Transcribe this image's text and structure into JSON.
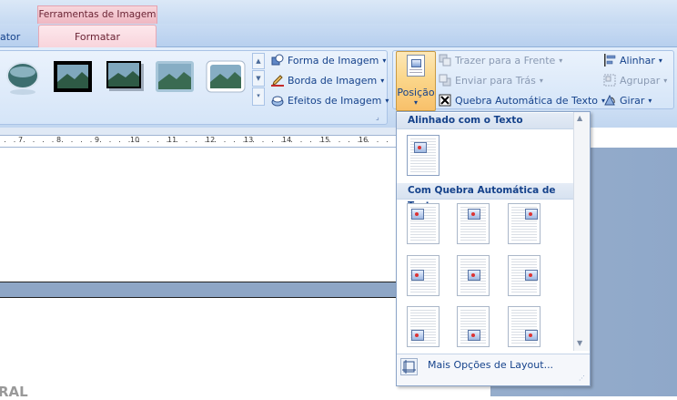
{
  "tabs": {
    "context_title": "Ferramentas de Imagem",
    "left_tab_partial": "ator",
    "active_tab": "Formatar"
  },
  "picture_styles": {
    "items": [
      "oval-reflected",
      "thick-black-frame",
      "drop-shadow-black",
      "soft-edge",
      "rounded-white-frame"
    ]
  },
  "picture_commands": {
    "shape": "Forma de Imagem",
    "border": "Borda de Imagem",
    "effects": "Efeitos de Imagem"
  },
  "arrange": {
    "position": "Posição",
    "bring_front": "Trazer para a Frente",
    "send_back": "Enviar para Trás",
    "text_wrap": "Quebra Automática de Texto",
    "align": "Alinhar",
    "group": "Agrupar",
    "rotate": "Girar"
  },
  "ruler": {
    "numbers": [
      "7",
      "8",
      "9",
      "10",
      "11",
      "12",
      "13",
      "14",
      "15",
      "16"
    ]
  },
  "position_menu": {
    "inline_header": "Alinhado com o Texto",
    "wrap_header": "Com Quebra Automática de Texto",
    "more_options": "Mais Opções de Layout..."
  },
  "document": {
    "partial_text": "RAL"
  },
  "colors": {
    "accent_pink": "#f8d3db",
    "ribbon_blue": "#cfe0f5",
    "text_blue": "#15428b",
    "highlight_orange": "#fbd78b"
  }
}
